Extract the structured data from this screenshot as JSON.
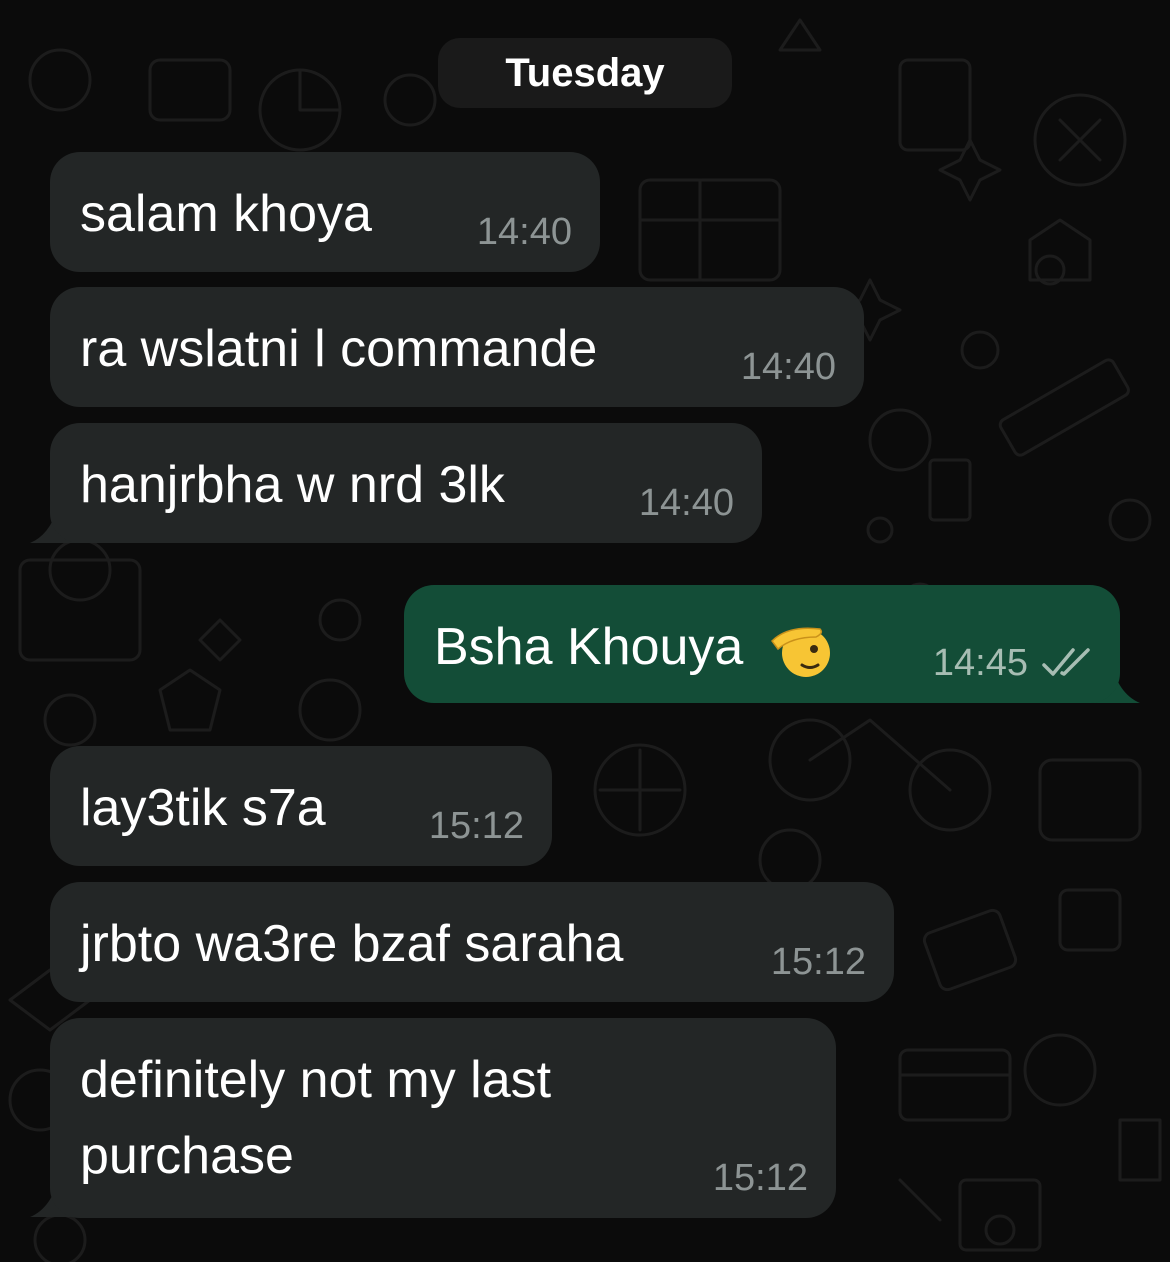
{
  "chat": {
    "date_separator": "Tuesday",
    "messages": [
      {
        "direction": "incoming",
        "text": "salam khoya",
        "time": "14:40"
      },
      {
        "direction": "incoming",
        "text": "ra wslatni l commande",
        "time": "14:40"
      },
      {
        "direction": "incoming",
        "text": "hanjrbha w nrd 3lk",
        "time": "14:40"
      },
      {
        "direction": "outgoing",
        "text": "Bsha Khouya",
        "emoji": "saluting-face-emoji",
        "time": "14:45",
        "status_icon": "double-check-icon"
      },
      {
        "direction": "incoming",
        "text": "lay3tik s7a",
        "time": "15:12"
      },
      {
        "direction": "incoming",
        "text": "jrbto wa3re bzaf saraha",
        "time": "15:12"
      },
      {
        "direction": "incoming",
        "text": "definitely not my last purchase",
        "time": "15:12"
      }
    ]
  },
  "colors": {
    "background": "#0b0b0b",
    "incoming_bubble": "#232626",
    "outgoing_bubble": "#134d37",
    "timestamp_incoming": "#8d9494",
    "timestamp_outgoing": "#a7bdb3"
  }
}
